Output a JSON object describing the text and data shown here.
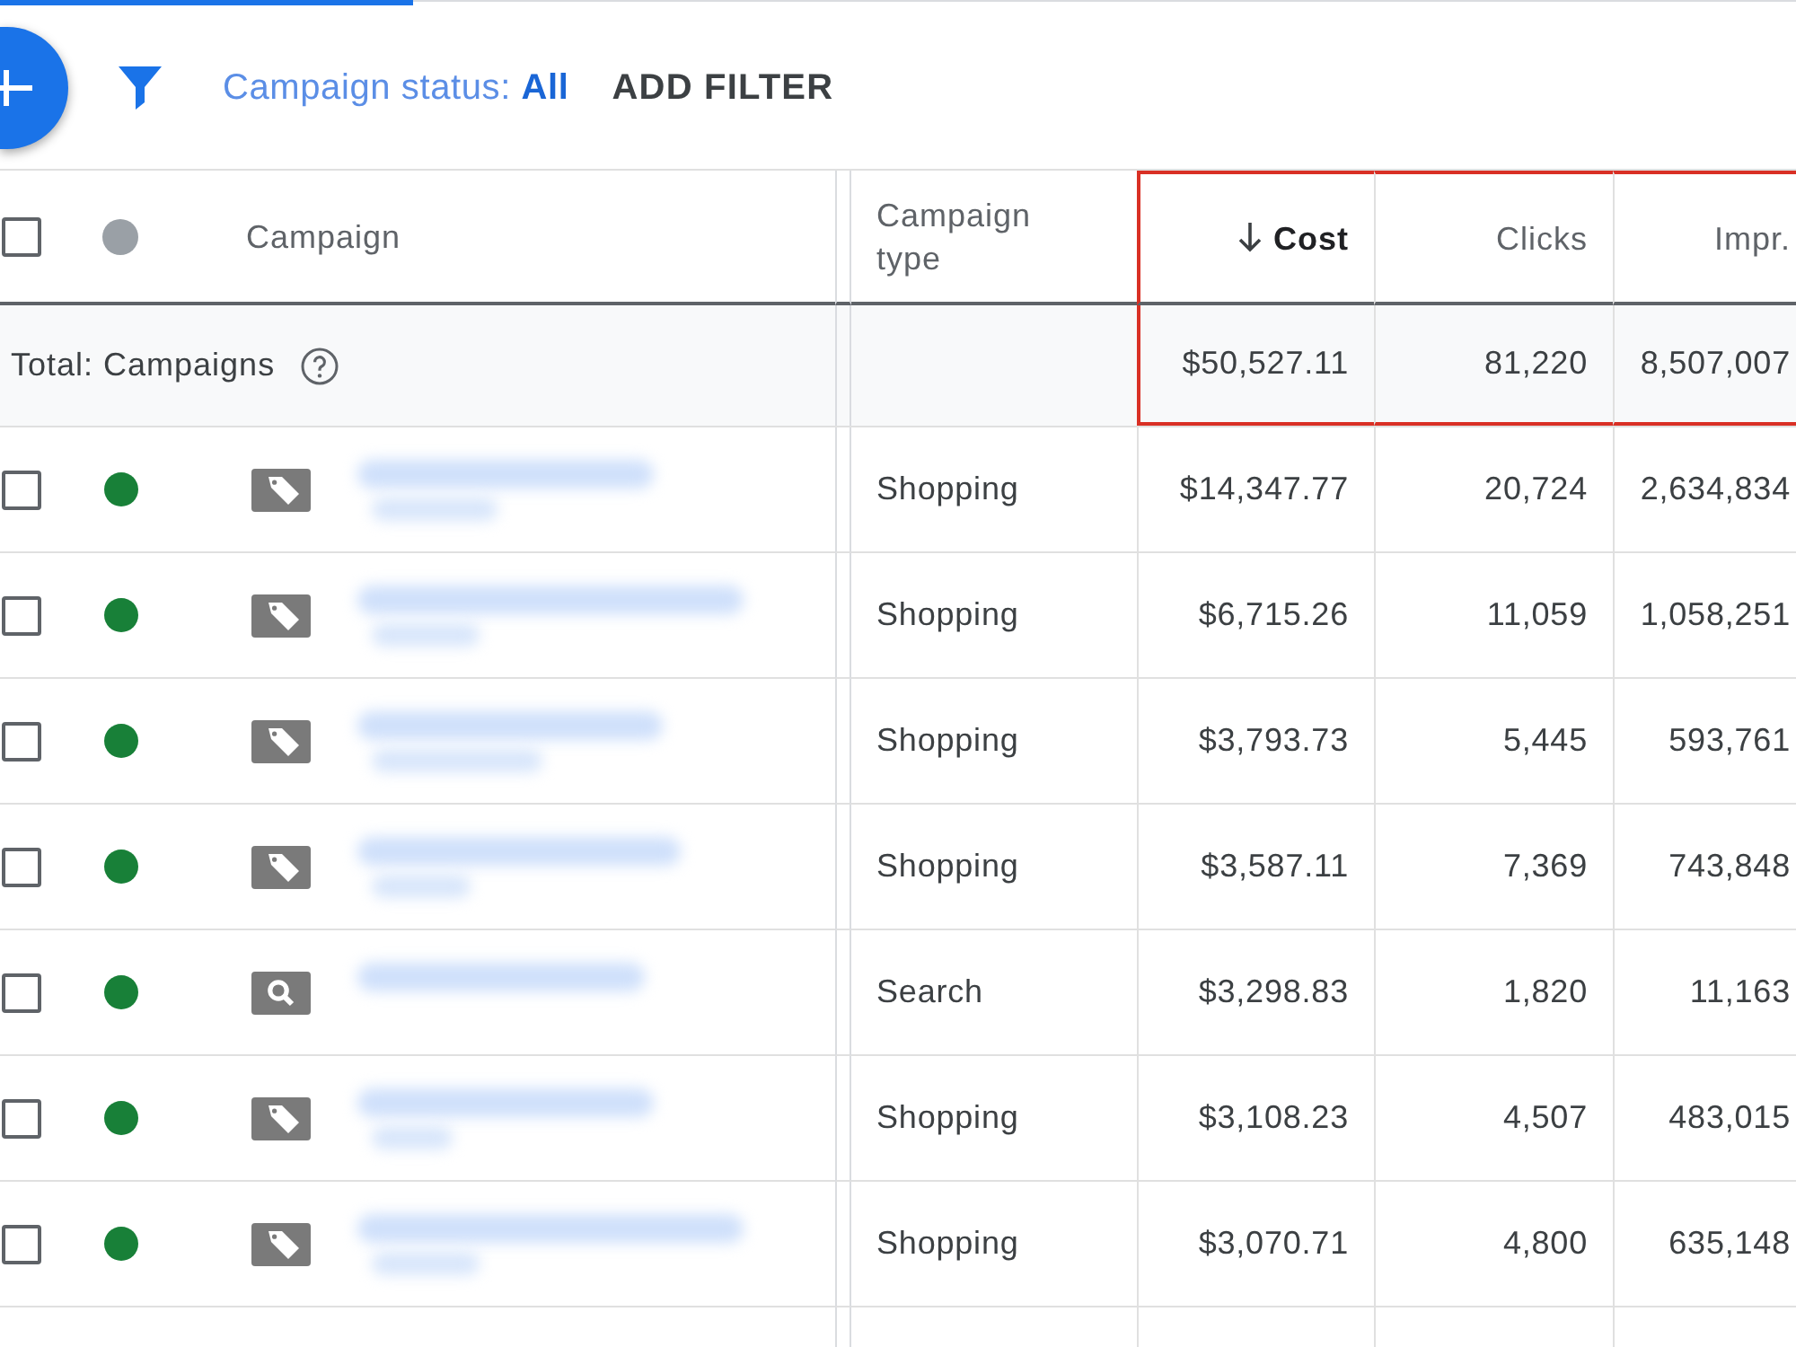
{
  "toolbar": {
    "status_filter": "Campaign status: **All**",
    "add_filter": "ADD FILTER"
  },
  "table": {
    "header_checkbox": {
      "checked": false
    },
    "columns": [
      {
        "label": "Campaign",
        "sorted": false,
        "highlighted": false
      },
      {
        "label": "Campaign type",
        "sorted": false,
        "highlighted": false
      },
      {
        "label": "Cost",
        "sorted": true,
        "highlighted": true
      },
      {
        "label": "Clicks",
        "sorted": false,
        "highlighted": true
      },
      {
        "label": "Impr.",
        "sorted": false,
        "highlighted": true
      }
    ],
    "total": {
      "label": "Total: Campaigns",
      "cost": "$50,527.11",
      "clicks": "81,220",
      "impressions": "8,507,007"
    },
    "rows": [
      {
        "checked": false,
        "color": "#188038",
        "kind": "shopping",
        "campaign_type": "Shopping",
        "cost": "$14,347.77",
        "clicks": "20,724",
        "impressions": "2,634,834"
      },
      {
        "checked": false,
        "color": "#188038",
        "kind": "shopping",
        "campaign_type": "Shopping",
        "cost": "$6,715.26",
        "clicks": "11,059",
        "impressions": "1,058,251"
      },
      {
        "checked": false,
        "color": "#188038",
        "kind": "shopping",
        "campaign_type": "Shopping",
        "cost": "$3,793.73",
        "clicks": "5,445",
        "impressions": "593,761"
      },
      {
        "checked": false,
        "color": "#188038",
        "kind": "shopping",
        "campaign_type": "Shopping",
        "cost": "$3,587.11",
        "clicks": "7,369",
        "impressions": "743,848"
      },
      {
        "checked": false,
        "color": "#188038",
        "kind": "search",
        "campaign_type": "Search",
        "cost": "$3,298.83",
        "clicks": "1,820",
        "impressions": "11,163"
      },
      {
        "checked": false,
        "color": "#188038",
        "kind": "shopping",
        "campaign_type": "Shopping",
        "cost": "$3,108.23",
        "clicks": "4,507",
        "impressions": "483,015"
      },
      {
        "checked": false,
        "color": "#188038",
        "kind": "shopping",
        "campaign_type": "Shopping",
        "cost": "$3,070.71",
        "clicks": "4,800",
        "impressions": "635,148"
      }
    ]
  }
}
